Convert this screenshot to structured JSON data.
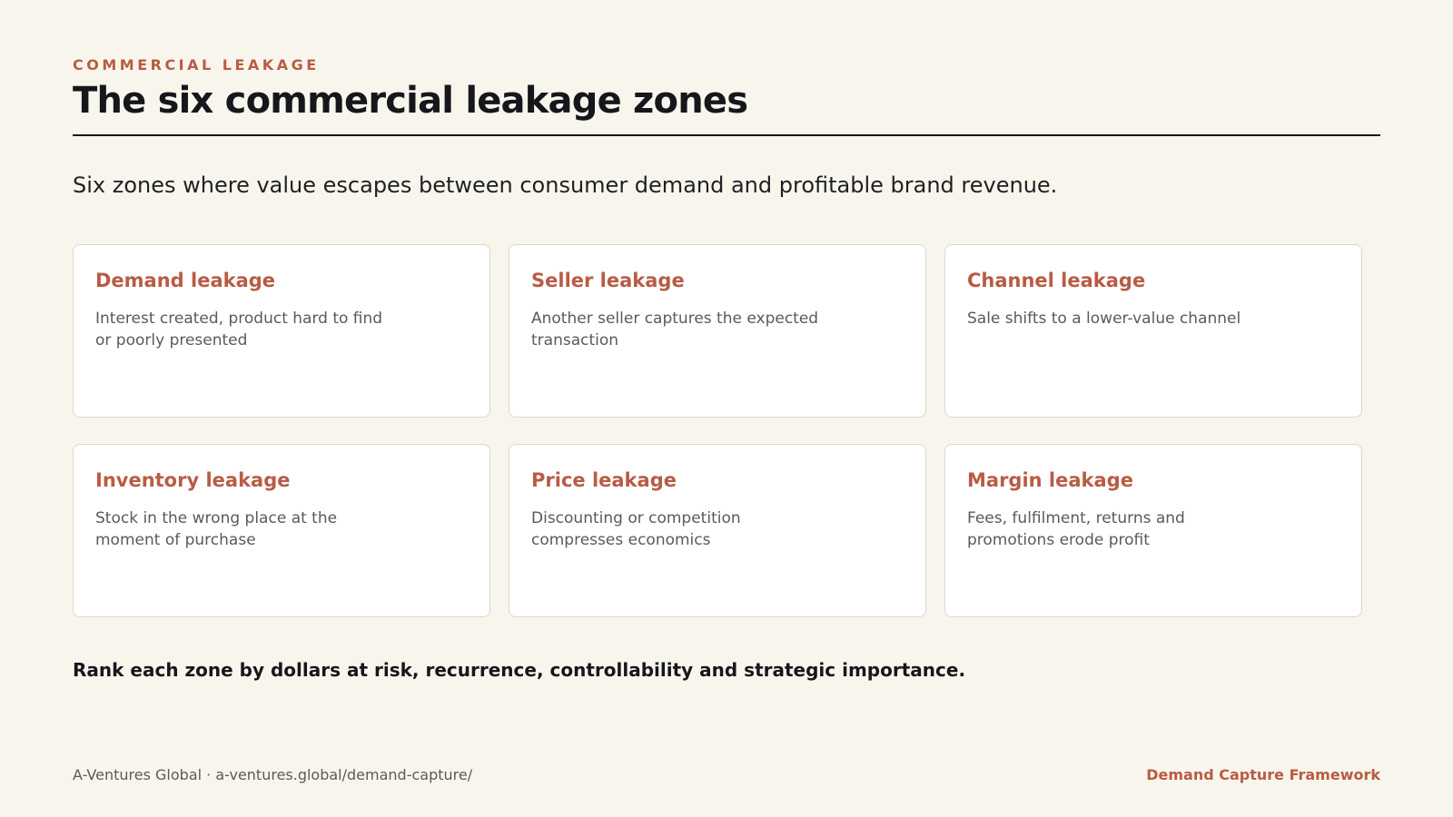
{
  "header": {
    "eyebrow": "COMMERCIAL LEAKAGE",
    "title": "The six commercial leakage zones"
  },
  "subtitle": "Six zones where value escapes between consumer demand and profitable brand revenue.",
  "zones": [
    {
      "title": "Demand leakage",
      "description": "Interest created, product hard to find or poorly presented"
    },
    {
      "title": "Seller leakage",
      "description": "Another seller captures the expected transaction"
    },
    {
      "title": "Channel leakage",
      "description": "Sale shifts to a lower-value channel"
    },
    {
      "title": "Inventory leakage",
      "description": "Stock in the wrong place at the moment of purchase"
    },
    {
      "title": "Price leakage",
      "description": "Discounting or competition compresses economics"
    },
    {
      "title": "Margin leakage",
      "description": "Fees, fulfilment, returns and promotions erode profit"
    }
  ],
  "callout": "Rank each zone by dollars at risk, recurrence, controllability and strategic importance.",
  "footer": {
    "source": "A-Ventures Global · a-ventures.global/demand-capture/",
    "brand": "Demand Capture Framework"
  },
  "colors": {
    "accent": "#b85c45",
    "background": "#f8f6ec",
    "text": "#16171c"
  }
}
